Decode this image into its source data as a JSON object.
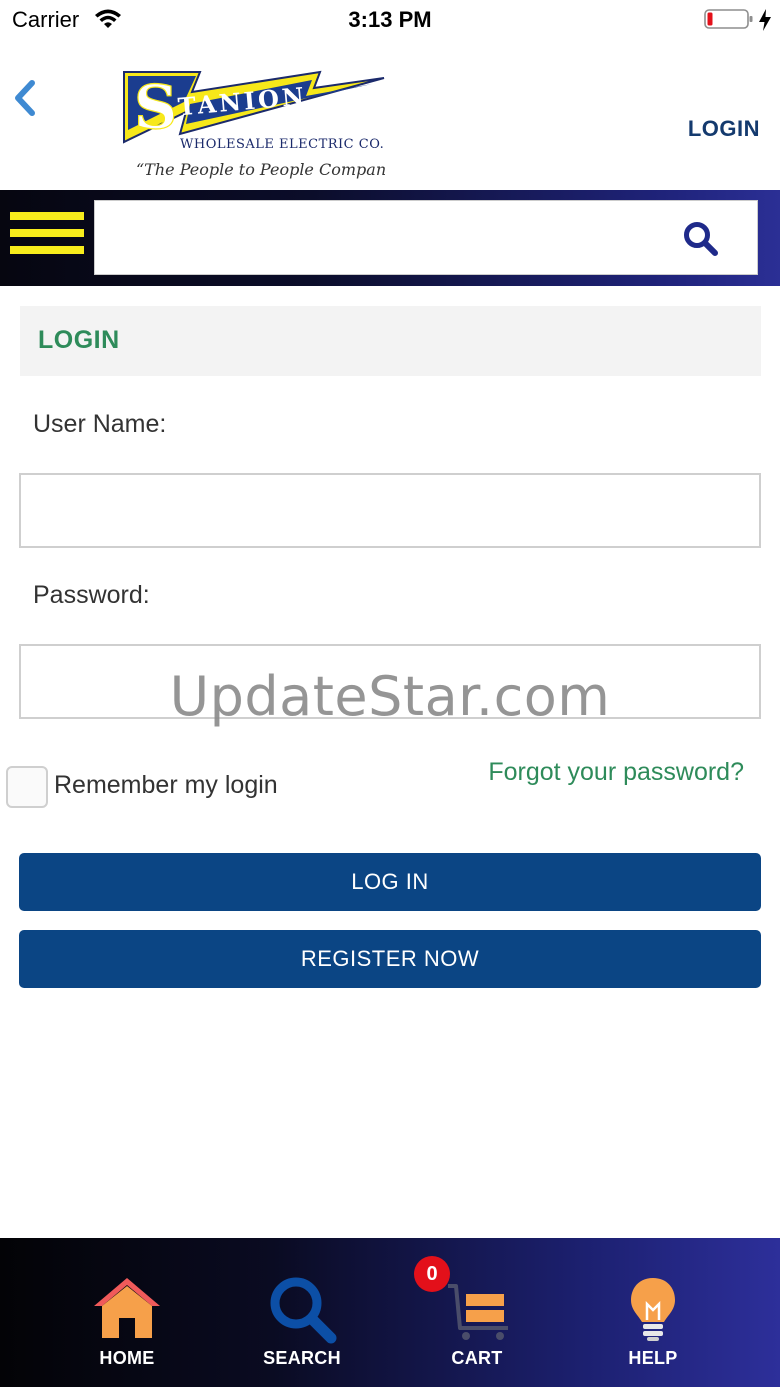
{
  "status_bar": {
    "carrier": "Carrier",
    "time": "3:13 PM",
    "battery_level_percent": 10
  },
  "header": {
    "logo": {
      "brand": "STANION",
      "tagline": "Wholesale Electric Co.",
      "slogan": "“The People to People Company”"
    },
    "login_link": "LOGIN"
  },
  "search": {
    "placeholder": ""
  },
  "login": {
    "title": "LOGIN",
    "username_label": "User Name:",
    "username_value": "",
    "password_label": "Password:",
    "password_value": "",
    "remember_label": "Remember my login",
    "remember_checked": false,
    "forgot_link": "Forgot your password?",
    "login_button": "LOG IN",
    "register_button": "REGISTER NOW"
  },
  "watermark": "UpdateStar.com",
  "bottom_nav": {
    "items": [
      {
        "label": "HOME",
        "icon": "home-icon"
      },
      {
        "label": "SEARCH",
        "icon": "search-icon"
      },
      {
        "label": "CART",
        "icon": "cart-icon",
        "badge": "0"
      },
      {
        "label": "HELP",
        "icon": "lightbulb-icon"
      }
    ]
  },
  "colors": {
    "accent_green": "#2e8b5a",
    "button_blue": "#0b4584",
    "brand_navy": "#143a6e",
    "menu_yellow": "#f7ec1c",
    "nav_orange": "#f6a04a",
    "badge_red": "#e3101a"
  }
}
